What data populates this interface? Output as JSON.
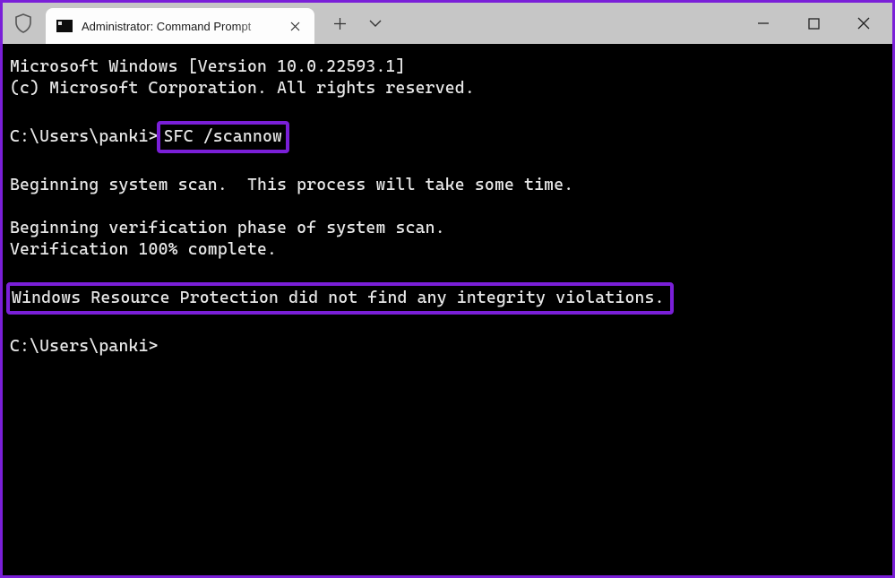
{
  "colors": {
    "accent_purple": "#7a1fd8",
    "titlebar_bg": "#c6c6c6",
    "tab_bg": "#fdfdfd",
    "terminal_bg": "#000000",
    "terminal_fg": "#e8e8e8"
  },
  "titlebar": {
    "shield_icon": "shield-icon",
    "tab": {
      "icon": "cmd-icon",
      "title": "Administrator: Command Prompt",
      "close_label": "Close tab"
    },
    "new_tab_label": "New tab",
    "tab_menu_label": "Tab dropdown",
    "window_controls": {
      "minimize": "Minimize",
      "maximize": "Maximize",
      "close": "Close"
    }
  },
  "terminal": {
    "line1": "Microsoft Windows [Version 10.0.22593.1]",
    "line2": "(c) Microsoft Corporation. All rights reserved.",
    "blank": "",
    "prompt1_prefix": "C:\\Users\\panki>",
    "command": "SFC /scannow",
    "line3": "Beginning system scan.  This process will take some time.",
    "line4": "Beginning verification phase of system scan.",
    "line5": "Verification 100% complete.",
    "result": "Windows Resource Protection did not find any integrity violations.",
    "prompt2": "C:\\Users\\panki>"
  }
}
